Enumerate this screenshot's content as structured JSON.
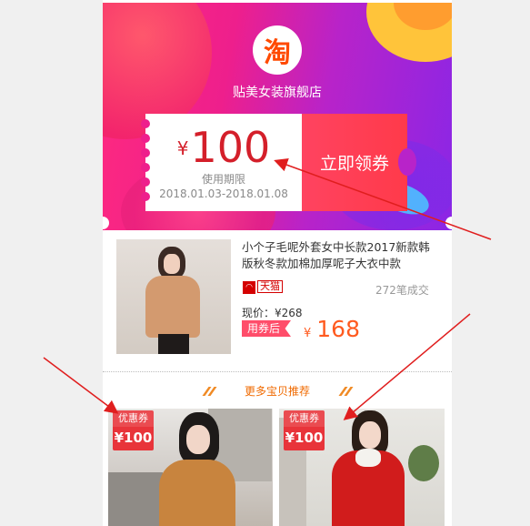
{
  "hero": {
    "logo_char": "淘",
    "shop_name": "贴美女装旗舰店"
  },
  "coupon": {
    "currency": "¥",
    "amount": "100",
    "validity_label": "使用期限",
    "validity_dates": "2018.01.03-2018.01.08",
    "claim_label": "立即领券"
  },
  "product": {
    "title": "小个子毛呢外套女中长款2017新款韩版秋冬款加棉加厚呢子大衣中款",
    "store_type": "天猫",
    "sales": "272笔成交",
    "current_price": "现价：¥268",
    "after_coupon_label": "用券后",
    "final_currency": "¥",
    "final_price": "168"
  },
  "recommend": {
    "title": "更多宝贝推荐",
    "cards": [
      {
        "coupon_label": "优惠券",
        "coupon_amount": "¥100"
      },
      {
        "coupon_label": "优惠券",
        "coupon_amount": "¥100"
      }
    ]
  },
  "colors": {
    "accent_red": "#e8343a",
    "price_orange": "#ff5a1f",
    "annotation_arrow": "#e01e1e"
  }
}
